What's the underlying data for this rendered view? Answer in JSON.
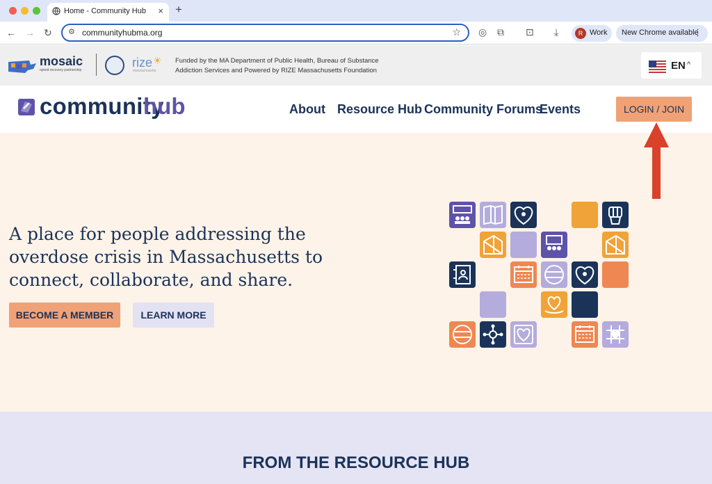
{
  "browser": {
    "tab_title": "Home - Community Hub",
    "url": "communityhubma.org",
    "profile_initial": "R",
    "profile_label": "Work",
    "update_label": "New Chrome available"
  },
  "funding": {
    "mosaic_name": "mosaic",
    "mosaic_tagline": "opioid recovery partnership",
    "rize_name": "rize",
    "rize_tagline": "massachusetts",
    "text": "Funded by the MA Department of Public Health, Bureau of Substance Addiction Services and Powered by RIZE Massachusetts Foundation",
    "language": "EN"
  },
  "header": {
    "logo_part1": "community",
    "logo_part2": "hub",
    "nav": [
      "About",
      "Resource Hub",
      "Community Forums",
      "Events"
    ],
    "login_label": "LOGIN / JOIN"
  },
  "hero": {
    "headline": "A place for people addressing the overdose crisis in Massachusetts to connect, collaborate, and share.",
    "primary_button": "BECOME A MEMBER",
    "secondary_button": "LEARN MORE"
  },
  "resource_hub": {
    "title": "FROM THE RESOURCE HUB"
  },
  "colors": {
    "navy": "#1b3359",
    "purple": "#5e53a8",
    "lavender": "#b3acdc",
    "orange": "#f0a338",
    "salmon": "#f0a276",
    "coral": "#ef8752",
    "hero_bg": "#fdf3e8",
    "section_bg": "#e4e4f4",
    "annotation_arrow": "#d9412b"
  },
  "icons": {
    "mosaic_tiles": [
      "people-icon",
      "map-icon",
      "heart-people-icon",
      "blank-tile",
      "fist-icon",
      "folded-map-icon",
      "blank-tile",
      "meeting-icon",
      "folded-map-icon",
      "contact-book-icon",
      "calendar-icon",
      "globe-icon",
      "heart-people-icon",
      "blank-tile",
      "blank-tile",
      "heart-hand-icon",
      "blank-tile",
      "globe-icon",
      "network-icon",
      "heart-icon",
      "calendar-icon",
      "heart-grid-icon"
    ]
  }
}
